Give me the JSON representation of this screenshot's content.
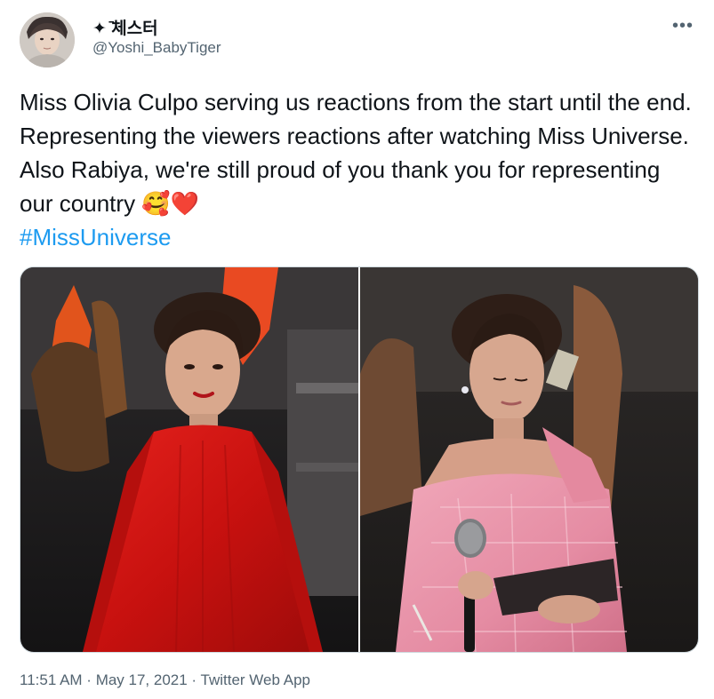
{
  "author": {
    "display_name": "✦ ̄체스터",
    "handle": "@Yoshi_BabyTiger",
    "avatar_icon": "profile-photo"
  },
  "more_icon": "more-options-icon",
  "tweet": {
    "text_part1": "Miss Olivia Culpo serving us reactions from the start until the end. Representing the viewers reactions after watching Miss Universe. Also Rabiya, we're still proud of you thank you for representing our country ",
    "emoji_smile": "🥰",
    "emoji_heart": "❤️",
    "hashtag": "#MissUniverse"
  },
  "media": {
    "photos": [
      {
        "description": "woman-in-red-gown-on-stage"
      },
      {
        "description": "woman-in-pink-gown-holding-microphone-and-card"
      }
    ]
  },
  "meta": {
    "time": "11:51 AM",
    "separator1": " · ",
    "date": "May 17, 2021",
    "separator2": " · ",
    "source": "Twitter Web App"
  },
  "colors": {
    "link": "#1d9bf0",
    "secondary_text": "#536471",
    "primary_text": "#0f1419"
  }
}
